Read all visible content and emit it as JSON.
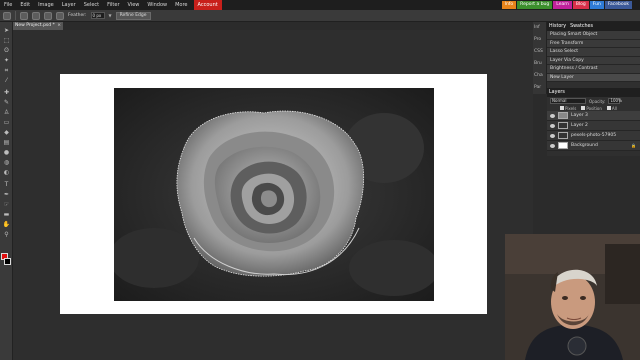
{
  "menu": [
    "File",
    "Edit",
    "Image",
    "Layer",
    "Select",
    "Filter",
    "View",
    "Window",
    "More"
  ],
  "account_label": "Account",
  "external_links": [
    {
      "label": "Info",
      "color": "#e8841a"
    },
    {
      "label": "Report a bug",
      "color": "#3c8f2d"
    },
    {
      "label": "Learn",
      "color": "#c0229b"
    },
    {
      "label": "Blog",
      "color": "#d9304a"
    },
    {
      "label": "Fun",
      "color": "#2f7bd6"
    },
    {
      "label": "Facebook",
      "color": "#3b5998"
    }
  ],
  "options": {
    "feather_label": "Feather:",
    "feather_value": "0 px",
    "refine_label": "Refine Edge"
  },
  "document_tab": {
    "title": "New Project.psd *",
    "close": "×"
  },
  "side_tabs": [
    "Inf",
    "Pro",
    "CSS",
    "Bru",
    "Cha",
    "Par",
    "LaC"
  ],
  "history": {
    "title": "History",
    "swatches_title": "Swatches",
    "items": [
      "Placing Smart Object",
      "Free Transform",
      "Lasso Select",
      "Layer Via Copy",
      "Brightness / Contrast",
      "New Layer"
    ]
  },
  "layers": {
    "title": "Layers",
    "blend_mode": "Normal",
    "opacity_label": "Opacity:",
    "opacity_value": "100%",
    "lock_options": [
      "Pixels",
      "Position",
      "All"
    ],
    "items": [
      "Layer 3",
      "Layer 2",
      "pexels-photo-57905",
      "Background"
    ]
  },
  "colors": {
    "foreground": "#e01010",
    "background": "#000000",
    "account_red": "#c8201b"
  }
}
